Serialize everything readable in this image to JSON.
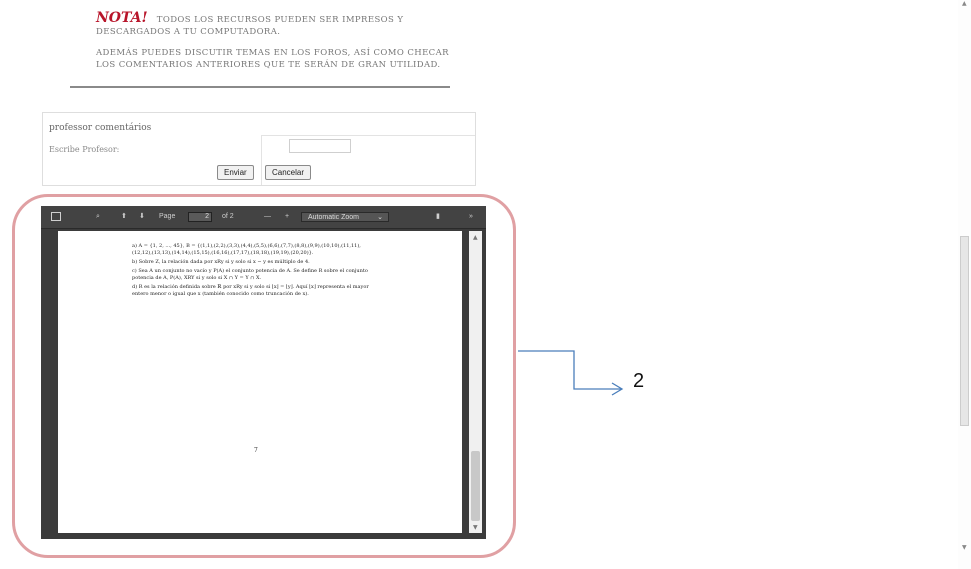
{
  "nota": {
    "title": "NOTA!",
    "line1": "Todos los recursos pueden ser impresos y descargados a tu computadora.",
    "line2": "Además puedes discutir temas en los foros, así como checar los comentarios anteriores que te serán de gran utilidad."
  },
  "comment_form": {
    "row1_label": "professor comentários",
    "name_label": "Escribe Profesor:",
    "submit_label": "Enviar",
    "cancel_label": "Cancelar"
  },
  "pdf_viewer": {
    "toolbar": {
      "page_label": "Page",
      "page_value": "2",
      "of_label": "of 2",
      "minus": "—",
      "plus": "+",
      "zoom_label": "Automatic Zoom",
      "more": "»"
    },
    "page_text": [
      "a) A = {1, 2, ..., 45}, B = {(1,1),(2,2),(3,3),(4,4),(5,5),(6,6),(7,7),(8,8),(9,9),(10,10),(11,11),(12,12),(13,13),(14,14),(15,15),(16,16),(17,17),(18,18),(19,19),(20,20)}.",
      "b) Sobre Z, la relación dada por xRy si y solo si x − y es múltiplo de 4.",
      "c) Sea A un conjunto no vacío y P(A) el conjunto potencia de A. Se define R sobre el conjunto potencia de A, P(A), XRY si y solo si X ∩ Y = Y ∩ X.",
      "d) R es la relación definida sobre ℝ por xRy si y solo si ⌊x⌋ = ⌊y⌋. Aquí ⌊x⌋ representa el mayor entero menor o igual que x (también conocido como truncación de x)."
    ],
    "page_number": "7"
  },
  "callout": {
    "label": "2",
    "color": "#4a7ebb"
  },
  "colors": {
    "highlight_border": "#e0a0a3",
    "nota_red": "#b8152a"
  }
}
